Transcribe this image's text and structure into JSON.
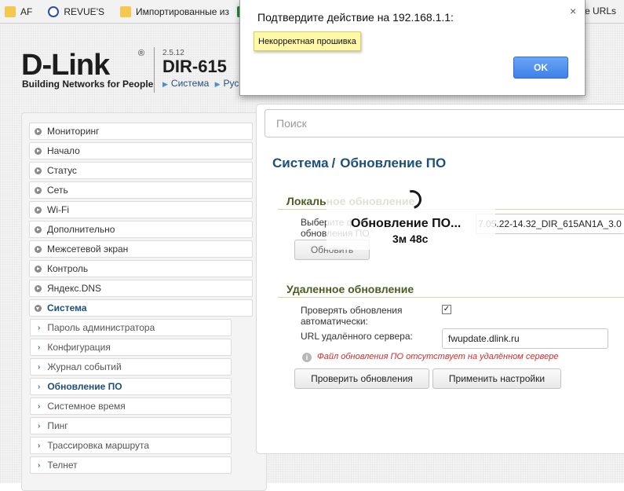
{
  "bookmarks": {
    "items": [
      {
        "label": "AF",
        "icon": "folder-icon"
      },
      {
        "label": "REVUE'S",
        "icon": "globe-icon"
      },
      {
        "label": "Импортированные из",
        "icon": "folder-icon"
      },
      {
        "label": "",
        "icon": "spreadsheet-icon"
      }
    ],
    "right_label": "ne URLs"
  },
  "header": {
    "logo_text": "D-Link",
    "logo_reg": "®",
    "logo_tagline": "Building Networks for People",
    "firmware_version": "2.5.12",
    "model": "DIR-615",
    "breadcrumb": "Система",
    "breadcrumb_next": "Рус"
  },
  "sidebar": {
    "items": [
      {
        "label": "Мониторинг"
      },
      {
        "label": "Начало"
      },
      {
        "label": "Статус"
      },
      {
        "label": "Сеть"
      },
      {
        "label": "Wi-Fi"
      },
      {
        "label": "Дополнительно"
      },
      {
        "label": "Межсетевой экран"
      },
      {
        "label": "Контроль"
      },
      {
        "label": "Яндекс.DNS"
      },
      {
        "label": "Система",
        "expanded": true
      }
    ],
    "subitems": [
      {
        "label": "Пароль администратора"
      },
      {
        "label": "Конфигурация"
      },
      {
        "label": "Журнал событий"
      },
      {
        "label": "Обновление ПО",
        "active": true
      },
      {
        "label": "Системное время"
      },
      {
        "label": "Пинг"
      },
      {
        "label": "Трассировка маршрута"
      },
      {
        "label": "Телнет"
      }
    ]
  },
  "main": {
    "search_placeholder": "Поиск",
    "title_part1": "Система",
    "title_sep": "/",
    "title_part2": "Обновление ПО",
    "local": {
      "heading": "Локальное обновление",
      "choose_label_line1": "Выберите ф",
      "choose_label_line2": "обновления ПО",
      "file_value": "7.05.22-14.32_DIR_615AN1A_3.0",
      "update_button": "Обновить"
    },
    "remote": {
      "heading": "Удаленное обновление",
      "auto_check_label_line1": "Проверять обновления",
      "auto_check_label_line2": "автоматически:",
      "auto_check_value": true,
      "auto_check_mark": "✓",
      "server_label": "URL удалённого сервера:",
      "server_value": "fwupdate.dlink.ru",
      "error_text": "Файл обновления ПО отсутствует на удалённом сервере",
      "info_icon_glyph": "i",
      "check_button": "Проверить обновления",
      "apply_button": "Применить настройки"
    }
  },
  "overlay": {
    "title": "Обновление ПО...",
    "time": "3м 48с"
  },
  "dialog": {
    "title": "Подтвердите действие на 192.168.1.1:",
    "message": "Некорректная прошивка",
    "ok_label": "OK",
    "close_glyph": "×"
  }
}
